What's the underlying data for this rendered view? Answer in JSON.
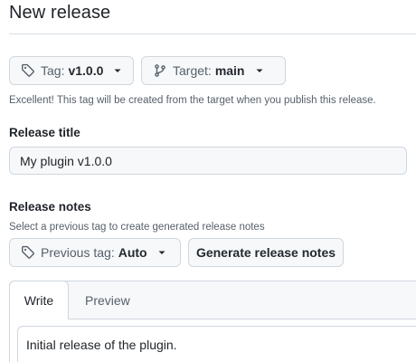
{
  "header": {
    "title": "New release"
  },
  "tag": {
    "label": "Tag:",
    "value": "v1.0.0"
  },
  "target": {
    "label": "Target:",
    "value": "main"
  },
  "tag_hint": "Excellent! This tag will be created from the target when you publish this release.",
  "release_title": {
    "label": "Release title",
    "value": "My plugin v1.0.0"
  },
  "release_notes": {
    "label": "Release notes",
    "hint": "Select a previous tag to create generated release notes",
    "previous_tag_label": "Previous tag:",
    "previous_tag_value": "Auto",
    "generate_label": "Generate release notes"
  },
  "editor": {
    "tabs": [
      {
        "label": "Write",
        "active": true
      },
      {
        "label": "Preview",
        "active": false
      }
    ],
    "content": "Initial release of the plugin."
  },
  "icons": {
    "tag": "tag-icon",
    "branch": "git-branch-icon",
    "caret": "caret-down-icon"
  }
}
